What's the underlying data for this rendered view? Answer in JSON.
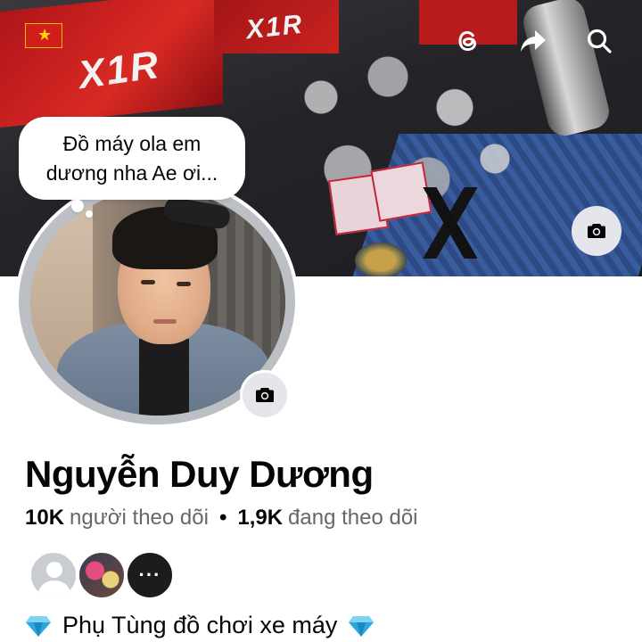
{
  "cover": {
    "logo_primary": "X1R",
    "logo_secondary": "X1R"
  },
  "top_actions": {
    "icons": [
      "threads-icon",
      "share-icon",
      "search-icon"
    ]
  },
  "profile": {
    "note": "Đồ máy ola em dương nha Ae ơi...",
    "name": "Nguyễn Duy Dương",
    "followers_count": "10K",
    "followers_label": "người theo dõi",
    "separator": "•",
    "following_count": "1,9K",
    "following_label": "đang theo dõi",
    "mutual_more": "···",
    "bio": "Phụ Tùng đồ chơi xe máy"
  },
  "colors": {
    "primary_text": "#050505",
    "secondary_text": "#65676b",
    "icon_button_bg": "#e4e6eb",
    "gem": "#29a8e0"
  }
}
